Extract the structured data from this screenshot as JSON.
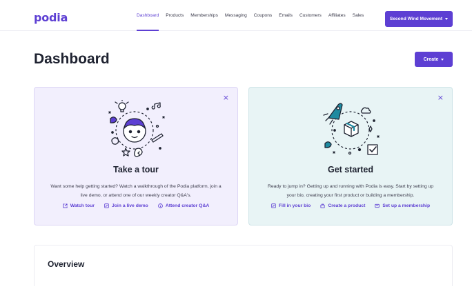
{
  "app": {
    "logo": "podia"
  },
  "nav": {
    "items": [
      {
        "label": "Dashboard",
        "active": true
      },
      {
        "label": "Products"
      },
      {
        "label": "Memberships"
      },
      {
        "label": "Messaging"
      },
      {
        "label": "Coupons"
      },
      {
        "label": "Emails"
      },
      {
        "label": "Customers"
      },
      {
        "label": "Affiliates"
      },
      {
        "label": "Sales"
      }
    ],
    "account_label": "Second Wind Movement"
  },
  "page": {
    "title": "Dashboard",
    "create_label": "Create"
  },
  "cards": {
    "tour": {
      "close": "×",
      "title": "Take a tour",
      "description": "Want some help getting started? Watch a walkthrough of the Podia platform, join a live demo, or attend one of our weekly creator Q&A's.",
      "links": [
        {
          "label": "Watch tour",
          "icon": "external-link-icon"
        },
        {
          "label": "Join a live demo",
          "icon": "edit-icon"
        },
        {
          "label": "Attend creator Q&A",
          "icon": "info-icon"
        }
      ]
    },
    "start": {
      "close": "×",
      "title": "Get started",
      "description": "Ready to jump in? Getting up and running with Podia is easy. Start by setting up your bio, creating your first product or building a membership.",
      "links": [
        {
          "label": "Fill in your bio",
          "icon": "edit-icon"
        },
        {
          "label": "Create a product",
          "icon": "bag-icon"
        },
        {
          "label": "Set up a membership",
          "icon": "membership-icon"
        }
      ]
    }
  },
  "overview": {
    "title": "Overview"
  },
  "colors": {
    "brand": "#5d3fd3",
    "tour_bg": "#f2effd",
    "start_bg": "#e8f4f5",
    "teal": "#1e8aa0"
  }
}
